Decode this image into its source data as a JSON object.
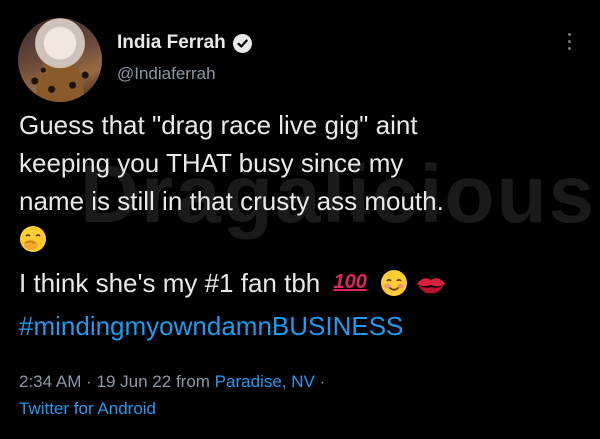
{
  "author": {
    "display_name": "India Ferrah",
    "handle": "@Indiaferrah",
    "verified": true
  },
  "watermark": "Dragalicious",
  "tweet": {
    "lines": [
      "Guess that \"drag race live gig\" aint",
      "keeping you THAT busy since my",
      "name is still in that crusty ass mouth."
    ],
    "line5": "I think she's my #1 fan tbh",
    "emoji_hundred": "100",
    "hashtag": "#mindingmyowndamnBUSINESS"
  },
  "meta": {
    "time": "2:34 AM",
    "separator1": "·",
    "date": "19 Jun 22",
    "from_label": "from",
    "location": "Paradise, NV",
    "separator2": "·",
    "source": "Twitter for Android"
  },
  "colors": {
    "background": "#000000",
    "text": "#e7e9ea",
    "secondary": "#8b98a5",
    "link": "#1d9bf0"
  }
}
